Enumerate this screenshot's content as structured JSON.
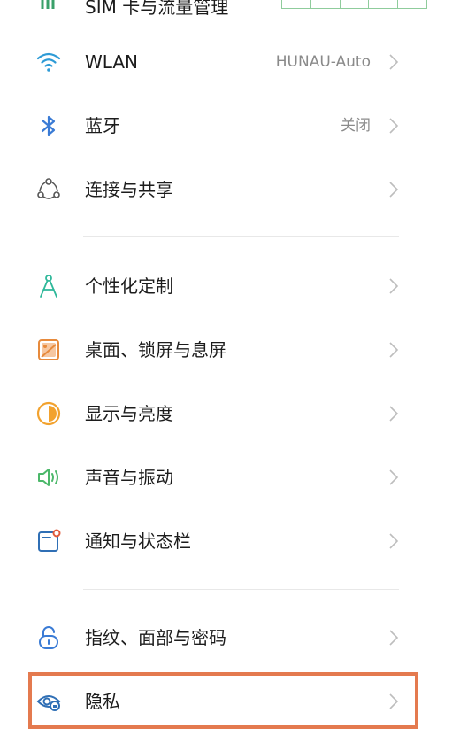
{
  "top": {
    "sim_label": "SIM 卡与流量管理"
  },
  "items": [
    {
      "label": "WLAN",
      "value": "HUNAU-Auto",
      "icon": "wifi-icon"
    },
    {
      "label": "蓝牙",
      "value": "关闭",
      "icon": "bluetooth-icon"
    },
    {
      "label": "连接与共享",
      "value": "",
      "icon": "connection-share-icon"
    },
    {
      "label": "个性化定制",
      "value": "",
      "icon": "personalization-icon"
    },
    {
      "label": "桌面、锁屏与息屏",
      "value": "",
      "icon": "desktop-lockscreen-icon"
    },
    {
      "label": "显示与亮度",
      "value": "",
      "icon": "display-brightness-icon"
    },
    {
      "label": "声音与振动",
      "value": "",
      "icon": "sound-vibration-icon"
    },
    {
      "label": "通知与状态栏",
      "value": "",
      "icon": "notification-statusbar-icon"
    },
    {
      "label": "指纹、面部与密码",
      "value": "",
      "icon": "lock-icon"
    },
    {
      "label": "隐私",
      "value": "",
      "icon": "privacy-eye-icon"
    }
  ],
  "colors": {
    "highlight": "#e47a4f",
    "wifi": "#2e9bd6",
    "bluetooth": "#3a7bd5",
    "personalization": "#2fb89a",
    "desktop": "#e78a3c",
    "display": "#f2a22e",
    "sound": "#4cb86a",
    "notification": "#2f6fb5",
    "lock": "#3a7bd5",
    "privacy": "#2f6fb5"
  }
}
